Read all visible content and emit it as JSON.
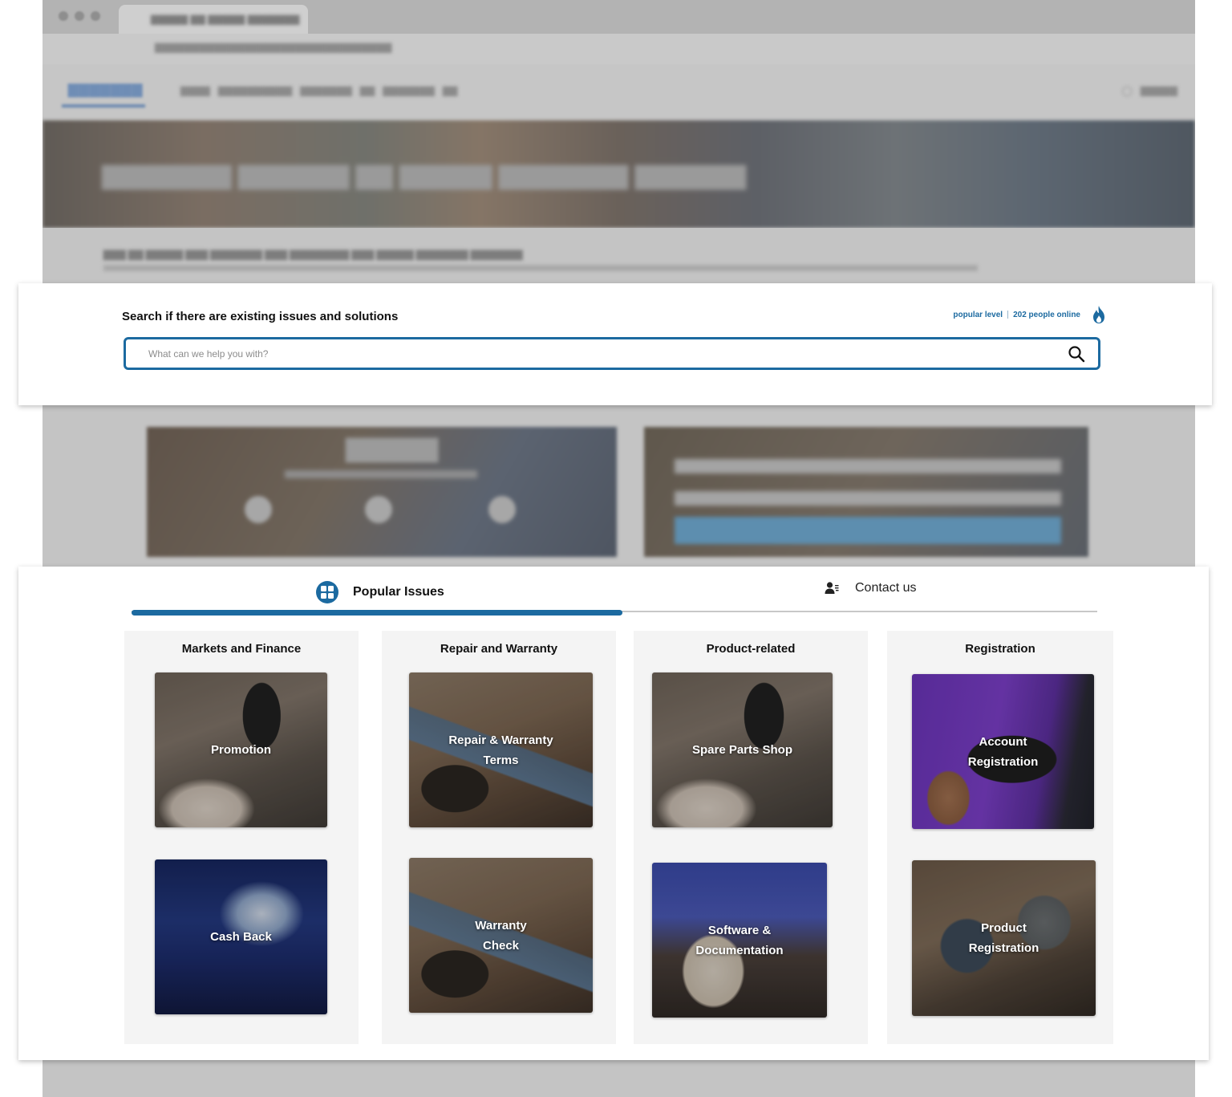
{
  "search": {
    "heading": "Search if there are existing issues and solutions",
    "popular_level_label": "popular level",
    "people_online": "202 people online",
    "placeholder": "What can we help you with?",
    "search_icon": "search-icon",
    "flame_icon": "flame-icon"
  },
  "tabs": [
    {
      "label": "Popular Issues",
      "icon": "grid-icon",
      "active": true
    },
    {
      "label": "Contact us",
      "icon": "contact-person-icon",
      "active": false
    }
  ],
  "columns": [
    {
      "title": "Markets and Finance",
      "cards": [
        {
          "label": "Promotion"
        },
        {
          "label": "Cash Back"
        }
      ]
    },
    {
      "title": "Repair and Warranty",
      "cards": [
        {
          "label": "Repair & Warranty Terms"
        },
        {
          "label": "Warranty Check"
        }
      ]
    },
    {
      "title": "Product-related",
      "cards": [
        {
          "label": "Spare Parts Shop"
        },
        {
          "label": "Software & Documentation"
        }
      ]
    },
    {
      "title": "Registration",
      "cards": [
        {
          "label": "Account Registration"
        },
        {
          "label": "Product Registration"
        }
      ]
    }
  ],
  "colors": {
    "accent": "#1c6aa0",
    "card_panel": "#f4f4f4",
    "dimmed_background": "#c4c4c4"
  }
}
